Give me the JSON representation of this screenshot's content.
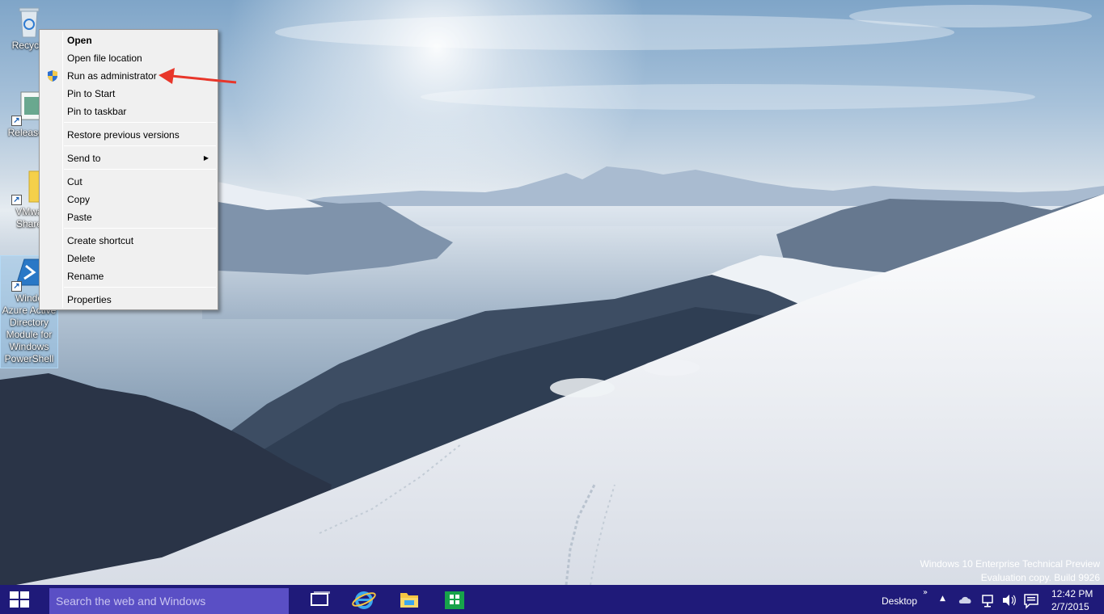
{
  "desktop_icons": [
    {
      "label": "Recycle"
    },
    {
      "label": "ReleaseN"
    },
    {
      "label": "VMwa\nShare"
    },
    {
      "label": "Windo\nAzure Active\nDirectory\nModule for\nWindows\nPowerShell"
    }
  ],
  "context_menu": {
    "items": [
      {
        "label": "Open"
      },
      {
        "label": "Open file location"
      },
      {
        "label": "Run as administrator"
      },
      {
        "label": "Pin to Start"
      },
      {
        "label": "Pin to taskbar"
      },
      {
        "label": "Restore previous versions"
      },
      {
        "label": "Send to"
      },
      {
        "label": "Cut"
      },
      {
        "label": "Copy"
      },
      {
        "label": "Paste"
      },
      {
        "label": "Create shortcut"
      },
      {
        "label": "Delete"
      },
      {
        "label": "Rename"
      },
      {
        "label": "Properties"
      }
    ]
  },
  "watermark": {
    "line1": "Windows 10 Enterprise Technical Preview",
    "line2": "Evaluation copy. Build 9926"
  },
  "taskbar": {
    "search_placeholder": "Search the web and Windows",
    "desktop_label": "Desktop",
    "time": "12:42 PM",
    "date": "2/7/2015",
    "colors": {
      "taskbar": "#1f1a79",
      "search_box": "#5a4fc5"
    }
  },
  "annotation": {
    "color": "#e8362a"
  }
}
